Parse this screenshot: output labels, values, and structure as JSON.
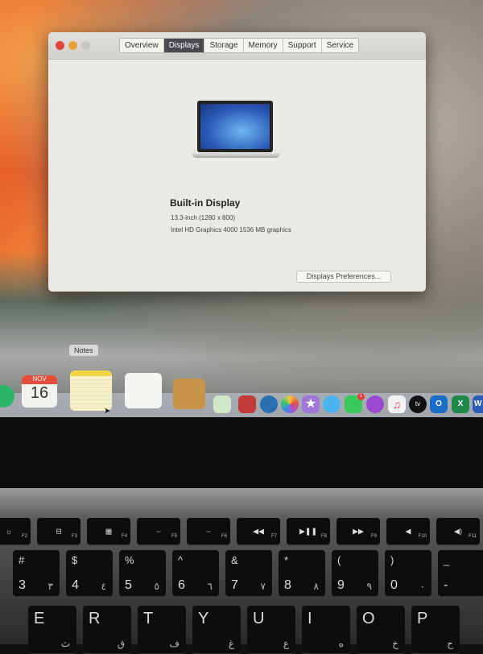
{
  "window": {
    "tabs": [
      {
        "label": "Overview"
      },
      {
        "label": "Displays",
        "active": true
      },
      {
        "label": "Storage"
      },
      {
        "label": "Memory"
      },
      {
        "label": "Support"
      },
      {
        "label": "Service"
      }
    ],
    "display_title": "Built-in Display",
    "display_size": "13.3-inch (1280 x 800)",
    "graphics": "Intel HD Graphics 4000 1536 MB graphics",
    "prefs_button": "Displays Preferences..."
  },
  "dock": {
    "tooltip": "Notes",
    "calendar_month": "NOV",
    "calendar_day": "16",
    "apps": [
      "finder",
      "calendar",
      "notes",
      "reminders",
      "contacts",
      "maps",
      "photo-booth",
      "quicktime",
      "photos",
      "imovie",
      "messages",
      "facetime",
      "podcasts",
      "music",
      "apple-tv",
      "outlook",
      "excel",
      "word"
    ],
    "facetime_badge": "1",
    "tv_label": "tv",
    "outlook_label": "O",
    "excel_label": "X",
    "word_label": "W"
  },
  "keyboard": {
    "function_row": [
      {
        "icon": "☼",
        "f": "F2"
      },
      {
        "icon": "⊟",
        "f": "F3"
      },
      {
        "icon": "▦",
        "f": "F4"
      },
      {
        "icon": "⌣",
        "f": "F5"
      },
      {
        "icon": "⌣",
        "f": "F6"
      },
      {
        "icon": "◀◀",
        "f": "F7"
      },
      {
        "icon": "▶❚❚",
        "f": "F8"
      },
      {
        "icon": "▶▶",
        "f": "F9"
      },
      {
        "icon": "◀",
        "f": "F10"
      },
      {
        "icon": "◀)",
        "f": "F11"
      }
    ],
    "number_row": [
      {
        "top": "#",
        "main": "3",
        "alt": "٣"
      },
      {
        "top": "$",
        "main": "4",
        "alt": "٤"
      },
      {
        "top": "%",
        "main": "5",
        "alt": "٥"
      },
      {
        "top": "^",
        "main": "6",
        "alt": "٦"
      },
      {
        "top": "&",
        "main": "7",
        "alt": "٧"
      },
      {
        "top": "*",
        "main": "8",
        "alt": "٨"
      },
      {
        "top": "(",
        "main": "9",
        "alt": "٩"
      },
      {
        "top": ")",
        "main": "0",
        "alt": "٠"
      },
      {
        "top": "_",
        "main": "-",
        "alt": ""
      }
    ],
    "letter_row": [
      {
        "top": "E",
        "main": "",
        "alt": "ث"
      },
      {
        "top": "R",
        "main": "",
        "alt": "ق"
      },
      {
        "top": "T",
        "main": "",
        "alt": "ف"
      },
      {
        "top": "Y",
        "main": "",
        "alt": "غ"
      },
      {
        "top": "U",
        "main": "",
        "alt": "ع"
      },
      {
        "top": "I",
        "main": "",
        "alt": "ه"
      },
      {
        "top": "O",
        "main": "",
        "alt": "خ"
      },
      {
        "top": "P",
        "main": "",
        "alt": "ح"
      }
    ]
  }
}
